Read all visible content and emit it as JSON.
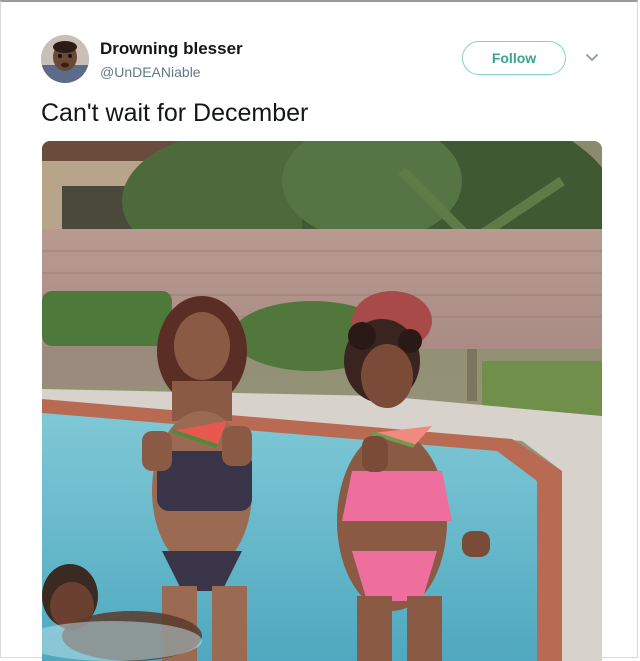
{
  "user": {
    "display_name": "Drowning blesser",
    "handle": "@UnDEANiable"
  },
  "actions": {
    "follow_label": "Follow"
  },
  "tweet": {
    "text": "Can't wait for December"
  },
  "icons": {
    "more": "chevron-down-icon"
  },
  "colors": {
    "follow_border": "#7fd3c6",
    "follow_text": "#3aa38e",
    "name": "#14171a",
    "handle": "#657786"
  }
}
